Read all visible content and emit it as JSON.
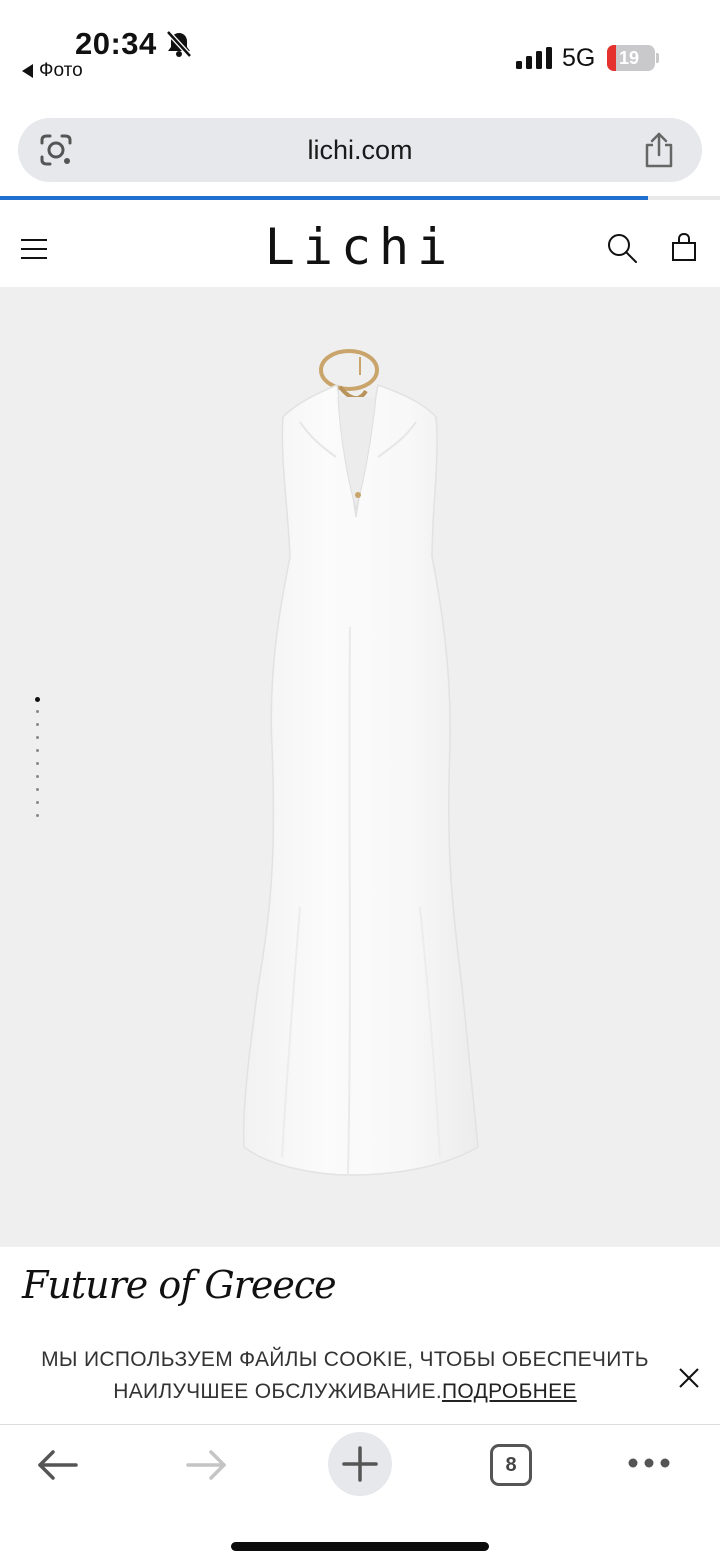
{
  "status_bar": {
    "time": "20:34",
    "back_label": "Фото",
    "network": "5G",
    "battery_level": "19",
    "battery_fraction": 0.19,
    "icons": [
      "bell-slash-icon",
      "signal-icon",
      "battery-icon"
    ]
  },
  "browser": {
    "url": "lichi.com",
    "load_progress": 0.9,
    "tab_count": "8",
    "accent": "#1f6fd1"
  },
  "site": {
    "logo": "Lichi",
    "header_icons": [
      "menu-icon",
      "search-icon",
      "bag-icon"
    ]
  },
  "product": {
    "image_count": 10,
    "active_image": 1,
    "background": "#efefef"
  },
  "collection": {
    "title": "Future of Greece"
  },
  "cookie": {
    "message": "МЫ ИСПОЛЬЗУЕМ ФАЙЛЫ COOKIE, ЧТОБЫ ОБЕСПЕЧИТЬ НАИЛУЧШЕЕ ОБСЛУЖИВАНИЕ.",
    "link": "ПОДРОБНЕЕ"
  },
  "toolbar": {
    "icons": [
      "back-arrow-icon",
      "forward-arrow-icon",
      "plus-icon",
      "tabs-icon",
      "more-icon"
    ]
  }
}
